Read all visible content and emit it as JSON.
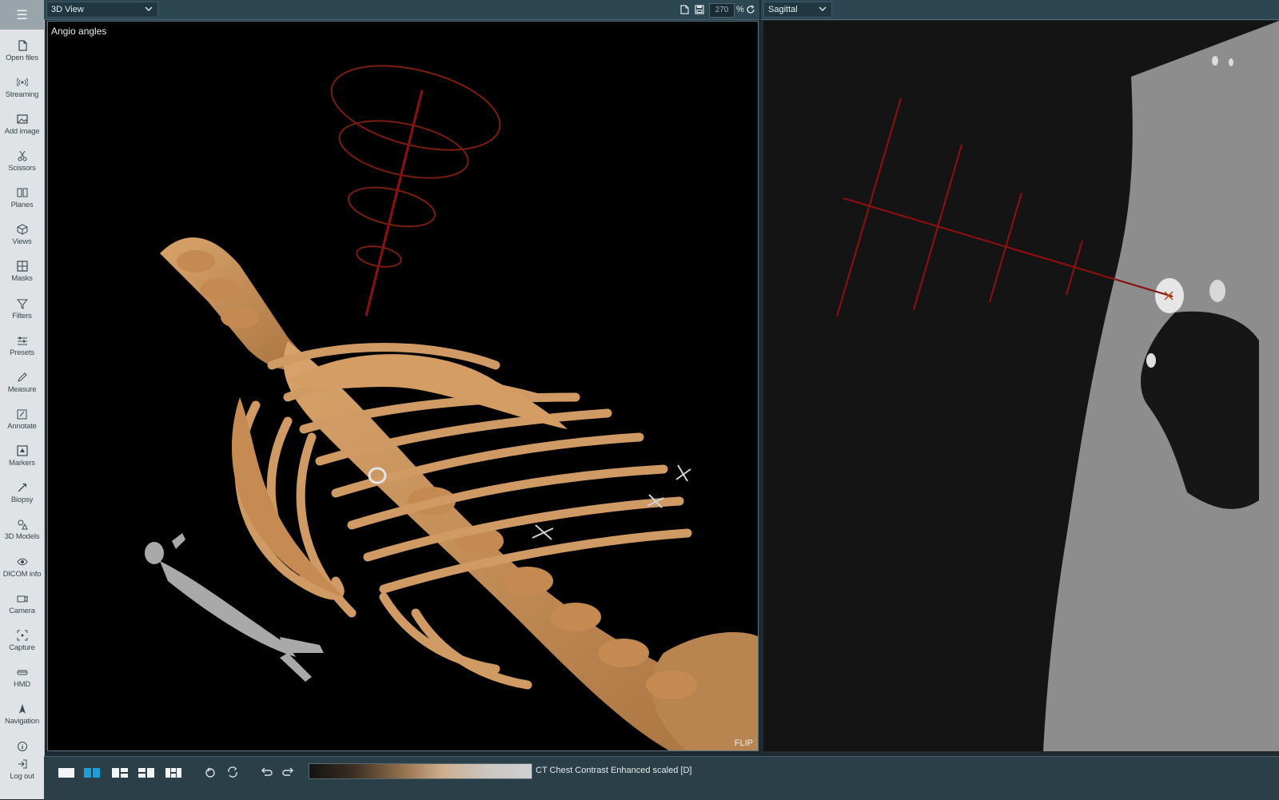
{
  "sidebar": {
    "items": [
      {
        "label": "Open files",
        "icon": "file-icon"
      },
      {
        "label": "Streaming",
        "icon": "streaming-icon"
      },
      {
        "label": "Add image",
        "icon": "image-icon"
      },
      {
        "label": "Scissors",
        "icon": "scissors-icon"
      },
      {
        "label": "Planes",
        "icon": "planes-icon"
      },
      {
        "label": "Views",
        "icon": "cube-icon"
      },
      {
        "label": "Masks",
        "icon": "grid-icon"
      },
      {
        "label": "Filters",
        "icon": "funnel-icon"
      },
      {
        "label": "Presets",
        "icon": "sliders-icon"
      },
      {
        "label": "Measure",
        "icon": "pencil-icon"
      },
      {
        "label": "Annotate",
        "icon": "annotate-icon"
      },
      {
        "label": "Markers",
        "icon": "marker-icon"
      },
      {
        "label": "Biopsy",
        "icon": "biopsy-icon"
      },
      {
        "label": "3D Models",
        "icon": "shapes-icon"
      },
      {
        "label": "DICOM info",
        "icon": "eye-icon"
      },
      {
        "label": "Camera",
        "icon": "camera-icon"
      },
      {
        "label": "Capture",
        "icon": "capture-icon"
      },
      {
        "label": "HMD",
        "icon": "hmd-icon"
      },
      {
        "label": "Navigation",
        "icon": "navigation-icon"
      },
      {
        "label": "",
        "icon": "info-icon"
      },
      {
        "label": "Log out",
        "icon": "logout-icon"
      }
    ]
  },
  "view3d": {
    "selector": "3D View",
    "zoom": "270",
    "zoom_unit": "%",
    "overlay_title": "Angio angles",
    "flip_label": "FLIP"
  },
  "sagittal": {
    "selector": "Sagittal"
  },
  "bottombar": {
    "dataset": "CT Chest Contrast Enhanced scaled [D]"
  },
  "colors": {
    "accent": "#1ea0d6",
    "bone": "#c8925e",
    "guide": "#8a1010"
  }
}
